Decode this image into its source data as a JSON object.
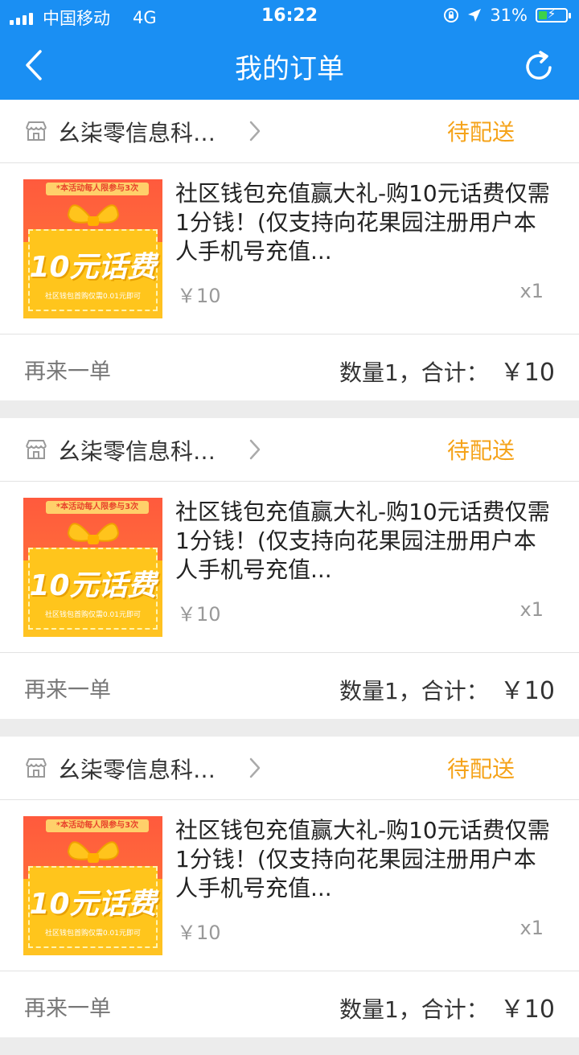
{
  "status_bar": {
    "carrier": "中国移动",
    "network": "4G",
    "time": "16:22",
    "battery": "31%",
    "battery_level": 0.31
  },
  "header": {
    "title": "我的订单"
  },
  "colors": {
    "header_bg": "#1a8ff3",
    "status_accent": "#f5a31a"
  },
  "orders": [
    {
      "shop_name": "幺柒零信息科…",
      "status": "待配送",
      "thumb": {
        "banner": "*本活动每人限参与3次",
        "headline": "10元话费",
        "caption": "社区钱包首购仅需0.01元即可"
      },
      "title": "社区钱包充值赢大礼-购10元话费仅需1分钱！(仅支持向花果园注册用户本人手机号充值...",
      "price": "￥10",
      "quantity": "x1",
      "reorder": "再来一单",
      "summary_label": "数量1，合计：",
      "total": "￥10"
    },
    {
      "shop_name": "幺柒零信息科…",
      "status": "待配送",
      "thumb": {
        "banner": "*本活动每人限参与3次",
        "headline": "10元话费",
        "caption": "社区钱包首购仅需0.01元即可"
      },
      "title": "社区钱包充值赢大礼-购10元话费仅需1分钱！(仅支持向花果园注册用户本人手机号充值...",
      "price": "￥10",
      "quantity": "x1",
      "reorder": "再来一单",
      "summary_label": "数量1，合计：",
      "total": "￥10"
    },
    {
      "shop_name": "幺柒零信息科…",
      "status": "待配送",
      "thumb": {
        "banner": "*本活动每人限参与3次",
        "headline": "10元话费",
        "caption": "社区钱包首购仅需0.01元即可"
      },
      "title": "社区钱包充值赢大礼-购10元话费仅需1分钱！(仅支持向花果园注册用户本人手机号充值...",
      "price": "￥10",
      "quantity": "x1",
      "reorder": "再来一单",
      "summary_label": "数量1，合计：",
      "total": "￥10"
    }
  ]
}
